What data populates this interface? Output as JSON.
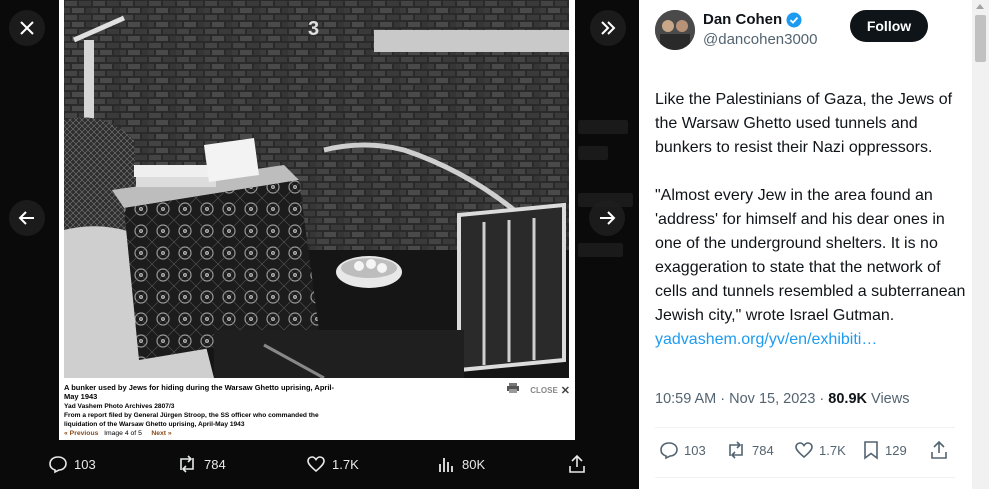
{
  "viewer": {
    "close_icon": "close-icon",
    "collapse_icon": "double-chevron-right-icon",
    "prev_icon": "arrow-left-icon",
    "next_icon": "arrow-right-icon",
    "photo_number": "3",
    "caption": {
      "line1": "A bunker used by Jews for hiding during the Warsaw Ghetto uprising, April-",
      "line2": "May 1943",
      "archive": "Yad Vashem Photo Archives 2807/3",
      "source1": "From a report filed by General Jürgen Stroop, the SS officer who commanded the",
      "source2": "liquidation of the Warsaw Ghetto uprising, April-May 1943",
      "prev": "« Previous",
      "counter": "Image 4 of 5",
      "next": "Next »",
      "close": "CLOSE"
    },
    "actions": {
      "replies": "103",
      "reposts": "784",
      "likes": "1.7K",
      "views": "80K"
    }
  },
  "tweet": {
    "display_name": "Dan Cohen",
    "handle": "@dancohen3000",
    "follow_label": "Follow",
    "text": "Like the Palestinians of Gaza, the Jews of the Warsaw Ghetto used tunnels and bunkers to resist their Nazi oppressors.\n\n\"Almost every Jew in the area found an 'address' for himself and his dear ones in one of the underground shelters. It is no exaggeration to state that the network of cells and tunnels resembled a subterranean Jewish city,\" wrote Israel Gutman.",
    "link": "yadvashem.org/yv/en/exhibiti…",
    "time": "10:59 AM · Nov 15, 2023 · ",
    "views_count": "80.9K",
    "views_label": " Views",
    "actions": {
      "replies": "103",
      "reposts": "784",
      "likes": "1.7K",
      "bookmarks": "129"
    }
  },
  "colors": {
    "link": "#1d9bf0",
    "verified": "#1d9bf0",
    "secondary_text": "#536471"
  }
}
